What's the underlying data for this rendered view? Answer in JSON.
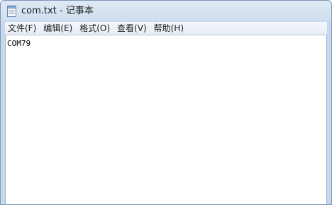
{
  "window": {
    "title": "com.txt - 记事本"
  },
  "menu": [
    {
      "label": "文件(F)"
    },
    {
      "label": "编辑(E)"
    },
    {
      "label": "格式(O)"
    },
    {
      "label": "查看(V)"
    },
    {
      "label": "帮助(H)"
    }
  ],
  "editor": {
    "content": "COM79"
  },
  "icons": {
    "app": "notepad-icon"
  },
  "colors": {
    "frame": "#cfdeef",
    "menubar": "#eef3f9",
    "text": "#1a1a1a"
  }
}
